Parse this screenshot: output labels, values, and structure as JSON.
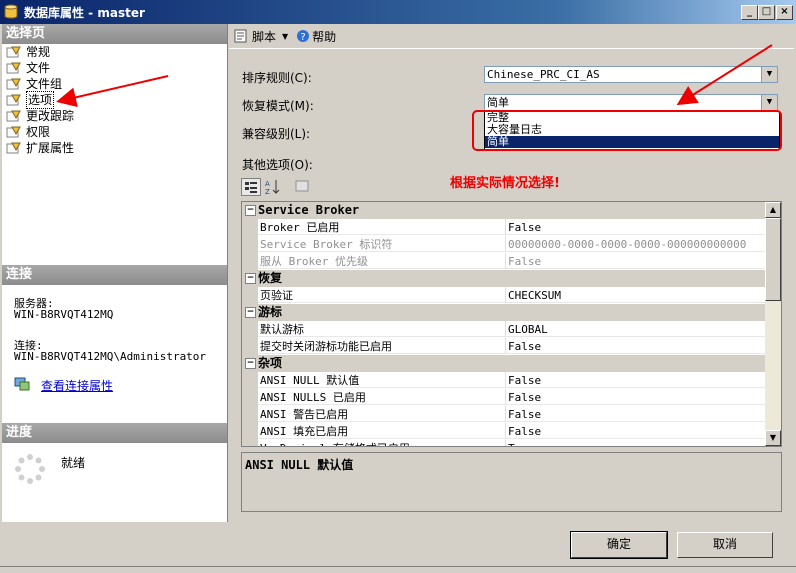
{
  "window": {
    "title": "数据库属性 - master"
  },
  "left": {
    "select_page_header": "选择页",
    "nav_items": [
      "常规",
      "文件",
      "文件组",
      "选项",
      "更改跟踪",
      "权限",
      "扩展属性"
    ],
    "connection_header": "连接",
    "server_label": "服务器:",
    "server_value": "WIN-B8RVQT412MQ",
    "connection_label": "连接:",
    "connection_value": "WIN-B8RVQT412MQ\\Administrator",
    "view_connection_link": "查看连接属性",
    "progress_header": "进度",
    "progress_status": "就绪"
  },
  "toolbar": {
    "script_label": "脚本",
    "help_label": "帮助"
  },
  "form": {
    "collation_label": "排序规则(C):",
    "collation_value": "Chinese_PRC_CI_AS",
    "recovery_label": "恢复模式(M):",
    "recovery_value": "简单",
    "compat_label": "兼容级别(L):",
    "other_label": "其他选项(O):",
    "recovery_options": [
      "完整",
      "大容量日志",
      "简单"
    ]
  },
  "annotation": "根据实际情况选择!",
  "grid": {
    "rows": [
      {
        "type": "cat",
        "name": "Service Broker"
      },
      {
        "type": "prop",
        "name": "Broker 已启用",
        "value": "False"
      },
      {
        "type": "prop",
        "name": "Service Broker 标识符",
        "value": "00000000-0000-0000-0000-000000000000",
        "grey": true
      },
      {
        "type": "prop",
        "name": "服从 Broker 优先级",
        "value": "False",
        "grey": true
      },
      {
        "type": "cat",
        "name": "恢复"
      },
      {
        "type": "prop",
        "name": "页验证",
        "value": "CHECKSUM"
      },
      {
        "type": "cat",
        "name": "游标"
      },
      {
        "type": "prop",
        "name": "默认游标",
        "value": "GLOBAL"
      },
      {
        "type": "prop",
        "name": "提交时关闭游标功能已启用",
        "value": "False"
      },
      {
        "type": "cat",
        "name": "杂项"
      },
      {
        "type": "prop",
        "name": "ANSI NULL 默认值",
        "value": "False"
      },
      {
        "type": "prop",
        "name": "ANSI NULLS 已启用",
        "value": "False"
      },
      {
        "type": "prop",
        "name": "ANSI 警告已启用",
        "value": "False"
      },
      {
        "type": "prop",
        "name": "ANSI 填充已启用",
        "value": "False"
      },
      {
        "type": "prop",
        "name": "VarDecimal 存储格式已启用",
        "value": "True"
      }
    ]
  },
  "description": "ANSI NULL 默认值",
  "buttons": {
    "ok": "确定",
    "cancel": "取消"
  },
  "colors": {
    "annotation_red": "#e00000",
    "selection_blue": "#0a246a"
  }
}
